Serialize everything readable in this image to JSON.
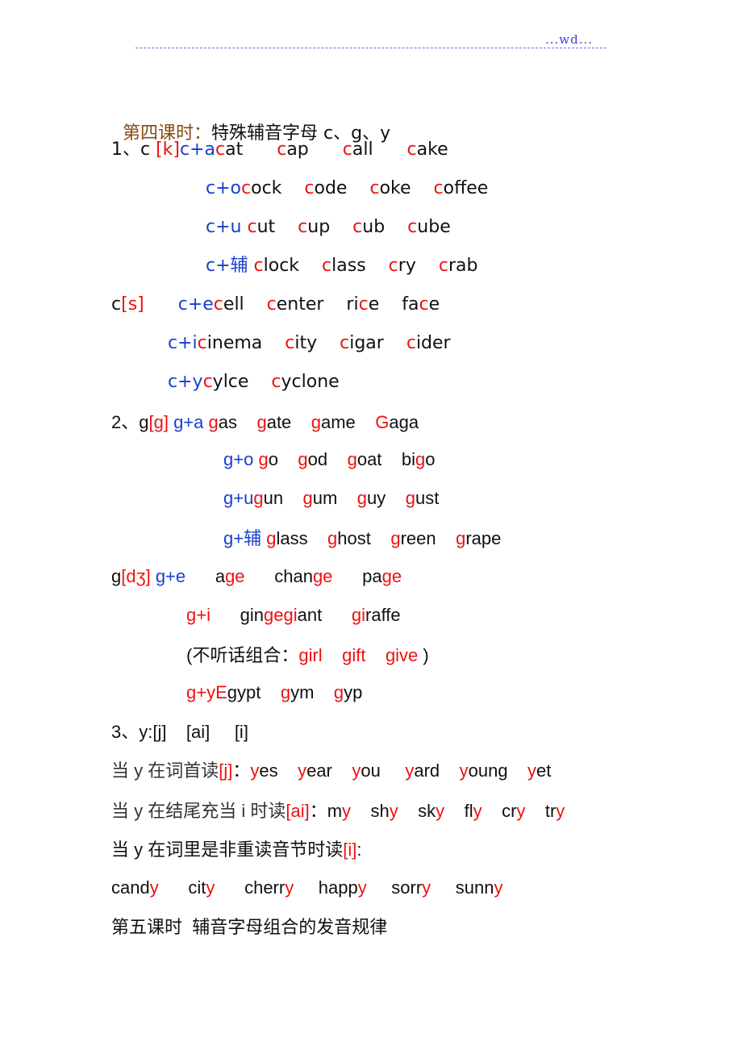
{
  "header": {
    "text": "...wd...",
    "rule_color": "#6f6fe0",
    "text_color": "#3d3ddc"
  },
  "colors": {
    "red": "#ee1111",
    "blue": "#1740d0",
    "brown": "#8a4a12",
    "black": "#111111"
  },
  "lesson4": {
    "title_prefix": "第四课时：",
    "title_rest": "特殊辅音字母 c、g、y"
  },
  "lines": [
    {
      "id": "c-k-a",
      "segments": [
        {
          "t": "1、c ",
          "c": "black"
        },
        {
          "t": "[k]",
          "c": "red"
        },
        {
          "t": "c+a",
          "c": "blue"
        },
        {
          "t": "c",
          "c": "red"
        },
        {
          "t": "at",
          "c": "black"
        },
        {
          "t": "      ",
          "c": "black"
        },
        {
          "t": "c",
          "c": "red"
        },
        {
          "t": "ap",
          "c": "black"
        },
        {
          "t": "      ",
          "c": "black"
        },
        {
          "t": "c",
          "c": "red"
        },
        {
          "t": "all",
          "c": "black"
        },
        {
          "t": "      ",
          "c": "black"
        },
        {
          "t": "c",
          "c": "red"
        },
        {
          "t": "ake",
          "c": "black"
        }
      ]
    },
    {
      "id": "c-o",
      "segments": [
        {
          "t": "c+o",
          "c": "blue"
        },
        {
          "t": "c",
          "c": "red"
        },
        {
          "t": "ock",
          "c": "black"
        },
        {
          "t": "    ",
          "c": "black"
        },
        {
          "t": "c",
          "c": "red"
        },
        {
          "t": "ode",
          "c": "black"
        },
        {
          "t": "    ",
          "c": "black"
        },
        {
          "t": "c",
          "c": "red"
        },
        {
          "t": "oke",
          "c": "black"
        },
        {
          "t": "    ",
          "c": "black"
        },
        {
          "t": "c",
          "c": "red"
        },
        {
          "t": "offee",
          "c": "black"
        }
      ]
    },
    {
      "id": "c-u",
      "segments": [
        {
          "t": "c+u ",
          "c": "blue"
        },
        {
          "t": "c",
          "c": "red"
        },
        {
          "t": "ut",
          "c": "black"
        },
        {
          "t": "    ",
          "c": "black"
        },
        {
          "t": "c",
          "c": "red"
        },
        {
          "t": "up",
          "c": "black"
        },
        {
          "t": "    ",
          "c": "black"
        },
        {
          "t": "c",
          "c": "red"
        },
        {
          "t": "ub",
          "c": "black"
        },
        {
          "t": "    ",
          "c": "black"
        },
        {
          "t": "c",
          "c": "red"
        },
        {
          "t": "ube",
          "c": "black"
        }
      ]
    },
    {
      "id": "c-consonant",
      "segments": [
        {
          "t": "c+辅 ",
          "c": "blue"
        },
        {
          "t": "c",
          "c": "red"
        },
        {
          "t": "lock",
          "c": "black"
        },
        {
          "t": "    ",
          "c": "black"
        },
        {
          "t": "c",
          "c": "red"
        },
        {
          "t": "lass",
          "c": "black"
        },
        {
          "t": "    ",
          "c": "black"
        },
        {
          "t": "c",
          "c": "red"
        },
        {
          "t": "ry",
          "c": "black"
        },
        {
          "t": "    ",
          "c": "black"
        },
        {
          "t": "c",
          "c": "red"
        },
        {
          "t": "rab",
          "c": "black"
        }
      ]
    },
    {
      "id": "c-s-e",
      "segments": [
        {
          "t": "c",
          "c": "black"
        },
        {
          "t": "[s]",
          "c": "red"
        },
        {
          "t": "      ",
          "c": "black"
        },
        {
          "t": "c+e",
          "c": "blue"
        },
        {
          "t": "c",
          "c": "red"
        },
        {
          "t": "ell",
          "c": "black"
        },
        {
          "t": "    ",
          "c": "black"
        },
        {
          "t": "c",
          "c": "red"
        },
        {
          "t": "enter",
          "c": "black"
        },
        {
          "t": "    ri",
          "c": "black"
        },
        {
          "t": "c",
          "c": "red"
        },
        {
          "t": "e",
          "c": "black"
        },
        {
          "t": "    fa",
          "c": "black"
        },
        {
          "t": "c",
          "c": "red"
        },
        {
          "t": "e",
          "c": "black"
        }
      ]
    },
    {
      "id": "c-i",
      "segments": [
        {
          "t": "c+i",
          "c": "blue"
        },
        {
          "t": "c",
          "c": "red"
        },
        {
          "t": "inema",
          "c": "black"
        },
        {
          "t": "    ",
          "c": "black"
        },
        {
          "t": "c",
          "c": "red"
        },
        {
          "t": "ity",
          "c": "black"
        },
        {
          "t": "    ",
          "c": "black"
        },
        {
          "t": "c",
          "c": "red"
        },
        {
          "t": "igar",
          "c": "black"
        },
        {
          "t": "    ",
          "c": "black"
        },
        {
          "t": "c",
          "c": "red"
        },
        {
          "t": "ider",
          "c": "black"
        }
      ]
    },
    {
      "id": "c-y",
      "segments": [
        {
          "t": "c+y",
          "c": "blue"
        },
        {
          "t": "c",
          "c": "red"
        },
        {
          "t": "ylce",
          "c": "black"
        },
        {
          "t": "    ",
          "c": "black"
        },
        {
          "t": "c",
          "c": "red"
        },
        {
          "t": "yclone",
          "c": "black"
        }
      ]
    },
    {
      "id": "g-g-a",
      "segments": [
        {
          "t": "2、g",
          "c": "black"
        },
        {
          "t": "[g]",
          "c": "red"
        },
        {
          "t": " g+a ",
          "c": "blue"
        },
        {
          "t": "g",
          "c": "red"
        },
        {
          "t": "as",
          "c": "black"
        },
        {
          "t": "    ",
          "c": "black"
        },
        {
          "t": "g",
          "c": "red"
        },
        {
          "t": "ate",
          "c": "black"
        },
        {
          "t": "    ",
          "c": "black"
        },
        {
          "t": "g",
          "c": "red"
        },
        {
          "t": "ame",
          "c": "black"
        },
        {
          "t": "    ",
          "c": "black"
        },
        {
          "t": "G",
          "c": "red"
        },
        {
          "t": "aga",
          "c": "black"
        }
      ]
    },
    {
      "id": "g-o",
      "segments": [
        {
          "t": "g+o ",
          "c": "blue"
        },
        {
          "t": "g",
          "c": "red"
        },
        {
          "t": "o",
          "c": "black"
        },
        {
          "t": "    ",
          "c": "black"
        },
        {
          "t": "g",
          "c": "red"
        },
        {
          "t": "od",
          "c": "black"
        },
        {
          "t": "    ",
          "c": "black"
        },
        {
          "t": "g",
          "c": "red"
        },
        {
          "t": "oat",
          "c": "black"
        },
        {
          "t": "    bi",
          "c": "black"
        },
        {
          "t": "g",
          "c": "red"
        },
        {
          "t": "o",
          "c": "black"
        }
      ]
    },
    {
      "id": "g-u",
      "segments": [
        {
          "t": "g+u",
          "c": "blue"
        },
        {
          "t": "g",
          "c": "red"
        },
        {
          "t": "un",
          "c": "black"
        },
        {
          "t": "    ",
          "c": "black"
        },
        {
          "t": "g",
          "c": "red"
        },
        {
          "t": "um",
          "c": "black"
        },
        {
          "t": "    ",
          "c": "black"
        },
        {
          "t": "g",
          "c": "red"
        },
        {
          "t": "uy",
          "c": "black"
        },
        {
          "t": "    ",
          "c": "black"
        },
        {
          "t": "g",
          "c": "red"
        },
        {
          "t": "ust",
          "c": "black"
        }
      ]
    },
    {
      "id": "g-consonant",
      "segments": [
        {
          "t": "g+辅 ",
          "c": "blue"
        },
        {
          "t": "g",
          "c": "red"
        },
        {
          "t": "lass",
          "c": "black"
        },
        {
          "t": "    ",
          "c": "black"
        },
        {
          "t": "g",
          "c": "red"
        },
        {
          "t": "host",
          "c": "black"
        },
        {
          "t": "    ",
          "c": "black"
        },
        {
          "t": "g",
          "c": "red"
        },
        {
          "t": "reen",
          "c": "black"
        },
        {
          "t": "    ",
          "c": "black"
        },
        {
          "t": "g",
          "c": "red"
        },
        {
          "t": "rape",
          "c": "black"
        }
      ]
    },
    {
      "id": "g-dz-e",
      "segments": [
        {
          "t": "g",
          "c": "black"
        },
        {
          "t": "[dʒ]",
          "c": "red"
        },
        {
          "t": " g+e",
          "c": "blue"
        },
        {
          "t": "      a",
          "c": "black"
        },
        {
          "t": "ge",
          "c": "red"
        },
        {
          "t": "      chan",
          "c": "black"
        },
        {
          "t": "ge",
          "c": "red"
        },
        {
          "t": "      pa",
          "c": "black"
        },
        {
          "t": "ge",
          "c": "red"
        }
      ]
    },
    {
      "id": "g-i",
      "segments": [
        {
          "t": "g+i",
          "c": "red"
        },
        {
          "t": "      gin",
          "c": "black"
        },
        {
          "t": "gegi",
          "c": "red"
        },
        {
          "t": "ant",
          "c": "black"
        },
        {
          "t": "      ",
          "c": "black"
        },
        {
          "t": "gi",
          "c": "red"
        },
        {
          "t": "raffe",
          "c": "black"
        }
      ]
    },
    {
      "id": "g-exceptions",
      "segments": [
        {
          "t": "(不听话组合：",
          "c": "black"
        },
        {
          "t": "girl",
          "c": "red"
        },
        {
          "t": "    ",
          "c": "black"
        },
        {
          "t": "gift",
          "c": "red"
        },
        {
          "t": "    ",
          "c": "black"
        },
        {
          "t": "give",
          "c": "red"
        },
        {
          "t": " )",
          "c": "black"
        }
      ]
    },
    {
      "id": "g-y",
      "segments": [
        {
          "t": "g+yE",
          "c": "red"
        },
        {
          "t": "gypt",
          "c": "black"
        },
        {
          "t": "    ",
          "c": "black"
        },
        {
          "t": "g",
          "c": "red"
        },
        {
          "t": "ym",
          "c": "black"
        },
        {
          "t": "    ",
          "c": "black"
        },
        {
          "t": "g",
          "c": "red"
        },
        {
          "t": "yp",
          "c": "black"
        }
      ]
    },
    {
      "id": "y-heading",
      "segments": [
        {
          "t": "3、y:[j]    [ai]     [i]",
          "c": "black"
        }
      ]
    },
    {
      "id": "y-initial",
      "segments": [
        {
          "t": "当 y 在词首读",
          "c": "gray"
        },
        {
          "t": "[j]",
          "c": "red"
        },
        {
          "t": "：",
          "c": "black"
        },
        {
          "t": "y",
          "c": "red"
        },
        {
          "t": "es",
          "c": "black"
        },
        {
          "t": "    ",
          "c": "black"
        },
        {
          "t": "y",
          "c": "red"
        },
        {
          "t": "ear",
          "c": "black"
        },
        {
          "t": "    ",
          "c": "black"
        },
        {
          "t": "y",
          "c": "red"
        },
        {
          "t": "ou",
          "c": "black"
        },
        {
          "t": "     ",
          "c": "black"
        },
        {
          "t": "y",
          "c": "red"
        },
        {
          "t": "ard",
          "c": "black"
        },
        {
          "t": "    ",
          "c": "black"
        },
        {
          "t": "y",
          "c": "red"
        },
        {
          "t": "oung",
          "c": "black"
        },
        {
          "t": "    ",
          "c": "black"
        },
        {
          "t": "y",
          "c": "red"
        },
        {
          "t": "et",
          "c": "black"
        }
      ]
    },
    {
      "id": "y-final",
      "segments": [
        {
          "t": "当 y 在结尾充当 i 时读",
          "c": "gray"
        },
        {
          "t": "[ai]",
          "c": "red"
        },
        {
          "t": "：m",
          "c": "black"
        },
        {
          "t": "y",
          "c": "red"
        },
        {
          "t": "    sh",
          "c": "black"
        },
        {
          "t": "y",
          "c": "red"
        },
        {
          "t": "    sk",
          "c": "black"
        },
        {
          "t": "y",
          "c": "red"
        },
        {
          "t": "    fl",
          "c": "black"
        },
        {
          "t": "y",
          "c": "red"
        },
        {
          "t": "    cr",
          "c": "black"
        },
        {
          "t": "y",
          "c": "red"
        },
        {
          "t": "    tr",
          "c": "black"
        },
        {
          "t": "y",
          "c": "red"
        }
      ]
    },
    {
      "id": "y-unstressed",
      "segments": [
        {
          "t": "当 y 在词里是非重读音节时读",
          "c": "black"
        },
        {
          "t": "[i]",
          "c": "red"
        },
        {
          "t": ":",
          "c": "black"
        }
      ]
    },
    {
      "id": "y-words",
      "segments": [
        {
          "t": "cand",
          "c": "black"
        },
        {
          "t": "y",
          "c": "red"
        },
        {
          "t": "      cit",
          "c": "black"
        },
        {
          "t": "y",
          "c": "red"
        },
        {
          "t": "      cherr",
          "c": "black"
        },
        {
          "t": "y",
          "c": "red"
        },
        {
          "t": "     happ",
          "c": "black"
        },
        {
          "t": "y",
          "c": "red"
        },
        {
          "t": "     sorr",
          "c": "black"
        },
        {
          "t": "y",
          "c": "red"
        },
        {
          "t": "     sunn",
          "c": "black"
        },
        {
          "t": "y",
          "c": "red"
        }
      ]
    }
  ],
  "lesson5": {
    "title": "第五课时  辅音字母组合的发音规律"
  }
}
